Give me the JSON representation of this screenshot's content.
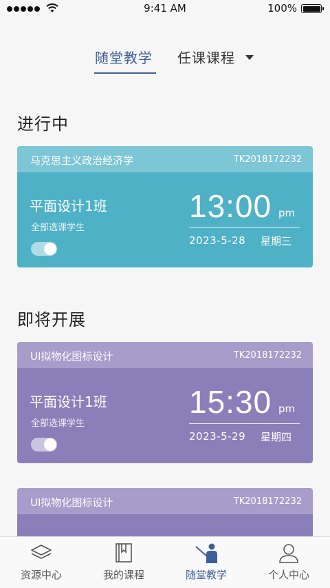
{
  "status_bar": {
    "time": "9:41 AM",
    "battery": "100%",
    "signal_icon": "signal-dots-icon",
    "wifi_icon": "wifi-icon",
    "battery_icon": "battery-icon",
    "battery_level": 1.0
  },
  "top_tabs": {
    "active": "随堂教学",
    "other": "任课课程",
    "other_icon": "caret-down-icon"
  },
  "sections": {
    "in_progress": "进行中",
    "upcoming": "即将开展"
  },
  "cards": [
    {
      "course": "马克思主义政治经济学",
      "code": "TK2018172232",
      "class_name": "平面设计1班",
      "sub_label": "全部选课学生",
      "toggle_on": true,
      "time": "13:00",
      "ampm": "pm",
      "date": "2023-5-28",
      "weekday": "星期三",
      "color_header": "#7cc6d6",
      "color_body": "#4fb1c6"
    },
    {
      "course": "UI拟物化图标设计",
      "code": "TK2018172232",
      "class_name": "平面设计1班",
      "sub_label": "全部选课学生",
      "toggle_on": true,
      "time": "15:30",
      "ampm": "pm",
      "date": "2023-5-29",
      "weekday": "星期四",
      "color_header": "#a89ccb",
      "color_body": "#8b7fb9"
    },
    {
      "course": "UI拟物化图标设计",
      "code": "TK2018172232",
      "color_header": "#a89ccb",
      "color_body": "#8b7fb9"
    }
  ],
  "bottom_nav": [
    {
      "label": "资源中心",
      "icon": "layers-icon",
      "active": false
    },
    {
      "label": "我的课程",
      "icon": "book-icon",
      "active": false
    },
    {
      "label": "随堂教学",
      "icon": "teacher-icon",
      "active": true
    },
    {
      "label": "个人中心",
      "icon": "user-icon",
      "active": false
    }
  ],
  "accent_color": "#3f5f9a"
}
